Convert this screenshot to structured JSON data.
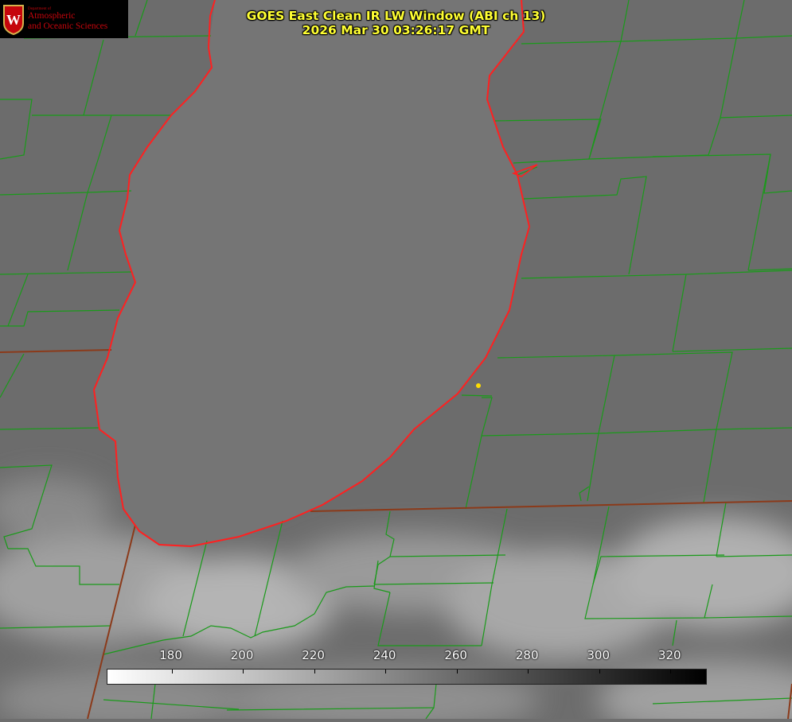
{
  "logo": {
    "dept": "Department of",
    "line1": "Atmospheric",
    "line2": "and Oceanic Sciences",
    "crest_icon": "uw-crest-icon",
    "crest_letter": "W"
  },
  "title": {
    "line1": "GOES East Clean IR LW Window (ABI ch 13)",
    "line2": "2026 Mar 30 03:26:17 GMT"
  },
  "colorbar": {
    "ticks": [
      "180",
      "200",
      "220",
      "240",
      "260",
      "280",
      "300",
      "320"
    ],
    "tick_values": [
      180,
      200,
      220,
      240,
      260,
      280,
      300,
      320
    ],
    "min": 162,
    "max": 330
  },
  "colors": {
    "county_lines": "#1a9a1a",
    "state_lines": "#8b3a1a",
    "coastline": "#ff2020",
    "marker": "#ffdd00",
    "title": "#ffff33"
  }
}
